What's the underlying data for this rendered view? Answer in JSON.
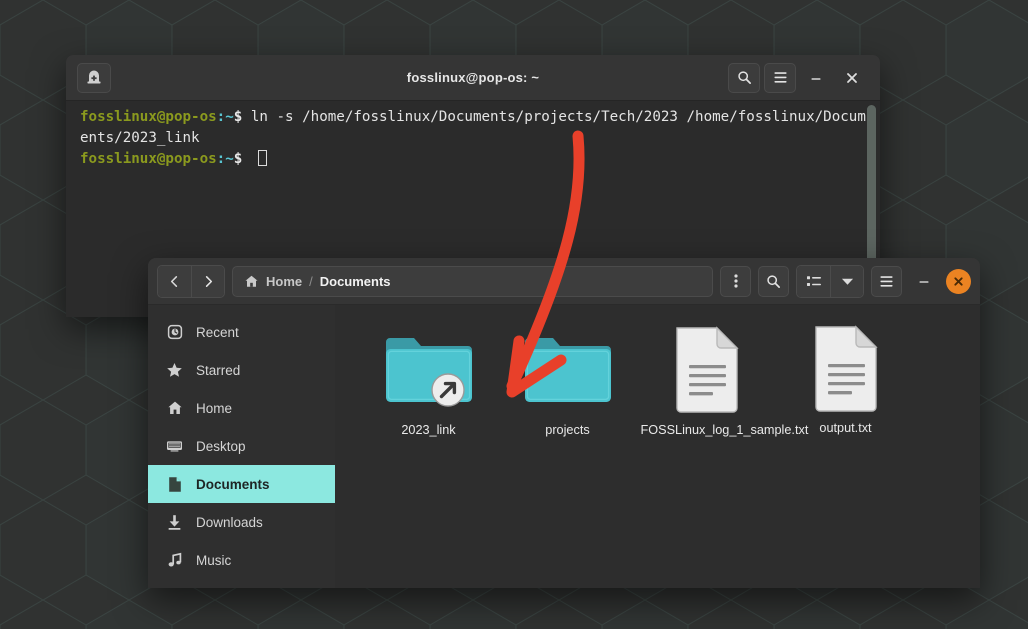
{
  "desktop": {
    "bg_color": "#313332",
    "pattern_color": "#4e6a66"
  },
  "terminal": {
    "title": "fosslinux@pop-os: ~",
    "newtab_icon": "new-tab-icon",
    "buttons": [
      {
        "name": "search-button",
        "icon": "search-icon"
      },
      {
        "name": "menu-button",
        "icon": "hamburger-icon"
      },
      {
        "name": "minimize-button",
        "icon": "minimize-icon",
        "glyph": "–"
      },
      {
        "name": "close-button",
        "icon": "close-icon",
        "glyph": "✕"
      }
    ],
    "lines": [
      {
        "user": "fosslinux@pop-os",
        "path": ":~",
        "dollar": "$ ",
        "command": "ln -s /home/fosslinux/Documents/projects/Tech/2023 /home/fosslinux/Documents/2023_link"
      },
      {
        "user": "fosslinux@pop-os",
        "path": ":~",
        "dollar": "$ ",
        "command": ""
      }
    ],
    "colors": {
      "prompt_user": "#8b9a1e",
      "prompt_path": "#59c6d2",
      "text": "#e4e4e4",
      "background": "#2b2b2b"
    }
  },
  "file_manager": {
    "nav": {
      "back": "‹",
      "forward": "›"
    },
    "breadcrumb": {
      "home_icon": "home-icon",
      "home": "Home",
      "separator": "/",
      "current": "Documents"
    },
    "toolbar": [
      {
        "name": "options-button",
        "icon": "kebab-menu-icon"
      },
      {
        "name": "search-button",
        "icon": "search-icon"
      },
      {
        "name": "view-list-button",
        "icon": "list-view-icon"
      },
      {
        "name": "view-dropdown-button",
        "icon": "chevron-down-icon"
      },
      {
        "name": "main-menu-button",
        "icon": "hamburger-icon"
      },
      {
        "name": "minimize-button",
        "icon": "minimize-icon",
        "glyph": "–"
      },
      {
        "name": "close-button",
        "icon": "close-icon",
        "glyph": "✕"
      }
    ],
    "sidebar": {
      "items": [
        {
          "label": "Recent",
          "icon": "clock-icon",
          "active": false
        },
        {
          "label": "Starred",
          "icon": "star-icon",
          "active": false
        },
        {
          "label": "Home",
          "icon": "home-icon",
          "active": false
        },
        {
          "label": "Desktop",
          "icon": "desktop-icon",
          "active": false
        },
        {
          "label": "Documents",
          "icon": "document-icon",
          "active": true
        },
        {
          "label": "Downloads",
          "icon": "download-icon",
          "active": false
        },
        {
          "label": "Music",
          "icon": "music-icon",
          "active": false
        }
      ],
      "active_color": "#8ce8e0"
    },
    "files": [
      {
        "name": "2023_link",
        "type": "folder",
        "symlink": true,
        "icon": "folder-symlink-icon"
      },
      {
        "name": "projects",
        "type": "folder",
        "symlink": false,
        "icon": "folder-icon"
      },
      {
        "name": "FOSSLinux_log_1_sample.txt",
        "type": "text",
        "symlink": false,
        "icon": "text-file-icon"
      },
      {
        "name": "output.txt",
        "type": "text",
        "symlink": false,
        "icon": "text-file-icon"
      }
    ],
    "folder_color": "#4cc4cf",
    "accent_close_color": "#eb8322"
  },
  "annotation": {
    "type": "curved-arrow",
    "color": "#e8402a",
    "points_to": "2023_link"
  }
}
